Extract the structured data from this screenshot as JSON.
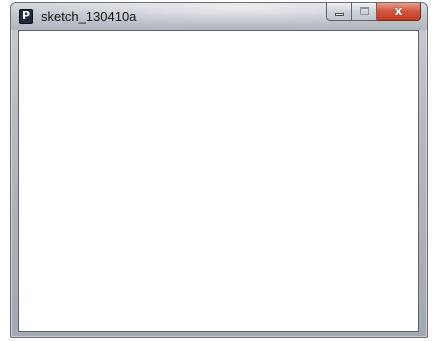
{
  "window": {
    "title": "sketch_130410a",
    "app_icon": {
      "name": "processing-icon",
      "glyph": "P"
    },
    "controls": {
      "minimize": {
        "icon": "minimize-icon"
      },
      "maximize": {
        "icon": "maximize-icon"
      },
      "close": {
        "icon": "close-icon",
        "glyph": "x"
      }
    }
  },
  "canvas": {
    "background": "#ffffff"
  },
  "colors": {
    "close_button": "#c23a23",
    "app_icon_bg": "#1f2a3a"
  }
}
